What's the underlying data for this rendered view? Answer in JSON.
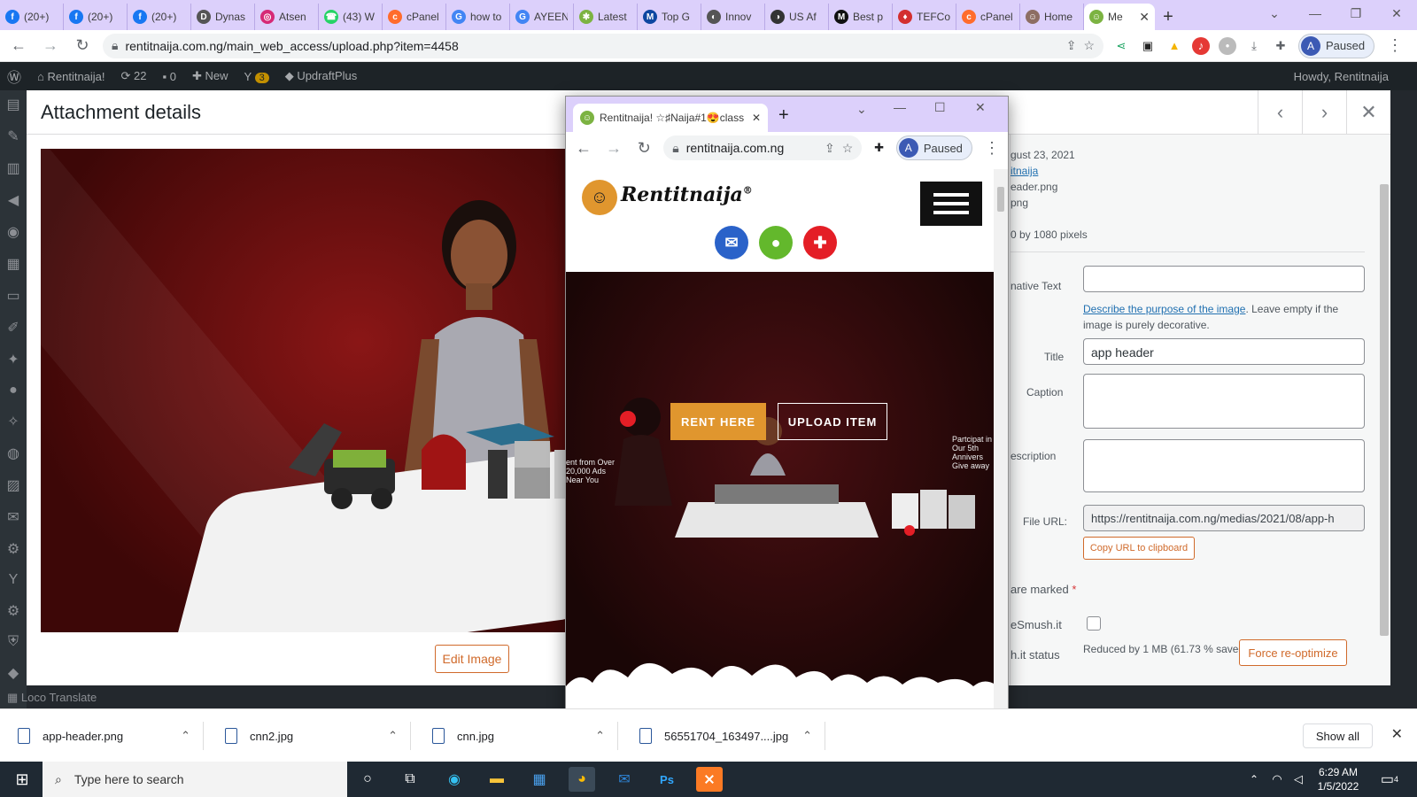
{
  "browser": {
    "tabs": [
      {
        "label": "(20+)",
        "fav": "f",
        "color": "#1877f2"
      },
      {
        "label": "(20+)",
        "fav": "f",
        "color": "#1877f2"
      },
      {
        "label": "(20+)",
        "fav": "f",
        "color": "#1877f2"
      },
      {
        "label": "Dynas",
        "fav": "D",
        "color": "#555555"
      },
      {
        "label": "Atsen",
        "fav": "◎",
        "color": "#d62976"
      },
      {
        "label": "(43) W",
        "fav": "☎",
        "color": "#25d366"
      },
      {
        "label": "cPanel",
        "fav": "c",
        "color": "#ff6c2c"
      },
      {
        "label": "how to",
        "fav": "G",
        "color": "#4285f4"
      },
      {
        "label": "AYEEN",
        "fav": "G",
        "color": "#4285f4"
      },
      {
        "label": "Latest",
        "fav": "✱",
        "color": "#7cb342"
      },
      {
        "label": "Top G",
        "fav": "M",
        "color": "#0d47a1"
      },
      {
        "label": "Innov",
        "fav": "◐",
        "color": "#555555"
      },
      {
        "label": "US Af",
        "fav": "◑",
        "color": "#333333"
      },
      {
        "label": "Best p",
        "fav": "M",
        "color": "#111111"
      },
      {
        "label": "TEFCo",
        "fav": "♦",
        "color": "#d32f2f"
      },
      {
        "label": "cPanel",
        "fav": "c",
        "color": "#ff6c2c"
      },
      {
        "label": "Home",
        "fav": "☺",
        "color": "#8d6e63"
      },
      {
        "label": "Me",
        "fav": "☺",
        "color": "#7cb342",
        "active": true
      }
    ],
    "url": "rentitnaija.com.ng/main_web_access/upload.php?item=4458",
    "profile_initial": "A",
    "profile_status": "Paused"
  },
  "adminbar": {
    "site": "Rentitnaija!",
    "updates": "22",
    "comments": "0",
    "new": "New",
    "yoast": "3",
    "updraft": "UpdraftPlus",
    "howdy": "Howdy, Rentitnaija"
  },
  "sidebar_bottom": "Loco Translate",
  "modal": {
    "title": "Attachment details",
    "edit_image": "Edit Image",
    "details": {
      "uploaded_on": "gust 23, 2021",
      "uploaded_by": "itnaija",
      "file_name": "eader.png",
      "file_type": "png",
      "dimensions": "0 by 1080 pixels",
      "alt_label": "native Text",
      "alt_help_link": "Describe the purpose of the image",
      "alt_help_rest": ". Leave empty if the image is purely decorative.",
      "title_label": "Title",
      "title_value": "app header",
      "caption_label": "Caption",
      "description_label": "escription",
      "fileurl_label": "File URL:",
      "fileurl_value": "https://rentitnaija.com.ng/medias/2021/08/app-h",
      "copy_button": "Copy URL to clipboard",
      "required_note": "are marked",
      "required_star": "*",
      "smush_label": "eSmush.it",
      "status_label": "h.it status",
      "status_value": "Reduced by 1 MB (61.73 % saved)",
      "force_button": "Force re-optimize"
    }
  },
  "popup": {
    "tab_title": "Rentitnaija! ☆♯Naija#1😍class",
    "url": "rentitnaija.com.ng",
    "profile_initial": "A",
    "profile_status": "Paused",
    "logo_text": "Rentitnaija",
    "logo_mark": "®",
    "rent_button": "RENT HERE",
    "upload_button": "UPLOAD ITEM",
    "hero_left_text": "ent from Over 20,000 Ads Near You",
    "hero_right_text": "Partcipat in Our 5th Annivers Give away"
  },
  "downloads": {
    "items": [
      "app-header.png",
      "cnn2.jpg",
      "cnn.jpg",
      "56551704_163497....jpg"
    ],
    "show_all": "Show all"
  },
  "taskbar": {
    "search_placeholder": "Type here to search",
    "time": "6:29 AM",
    "date": "1/5/2022",
    "notifications": "4"
  }
}
